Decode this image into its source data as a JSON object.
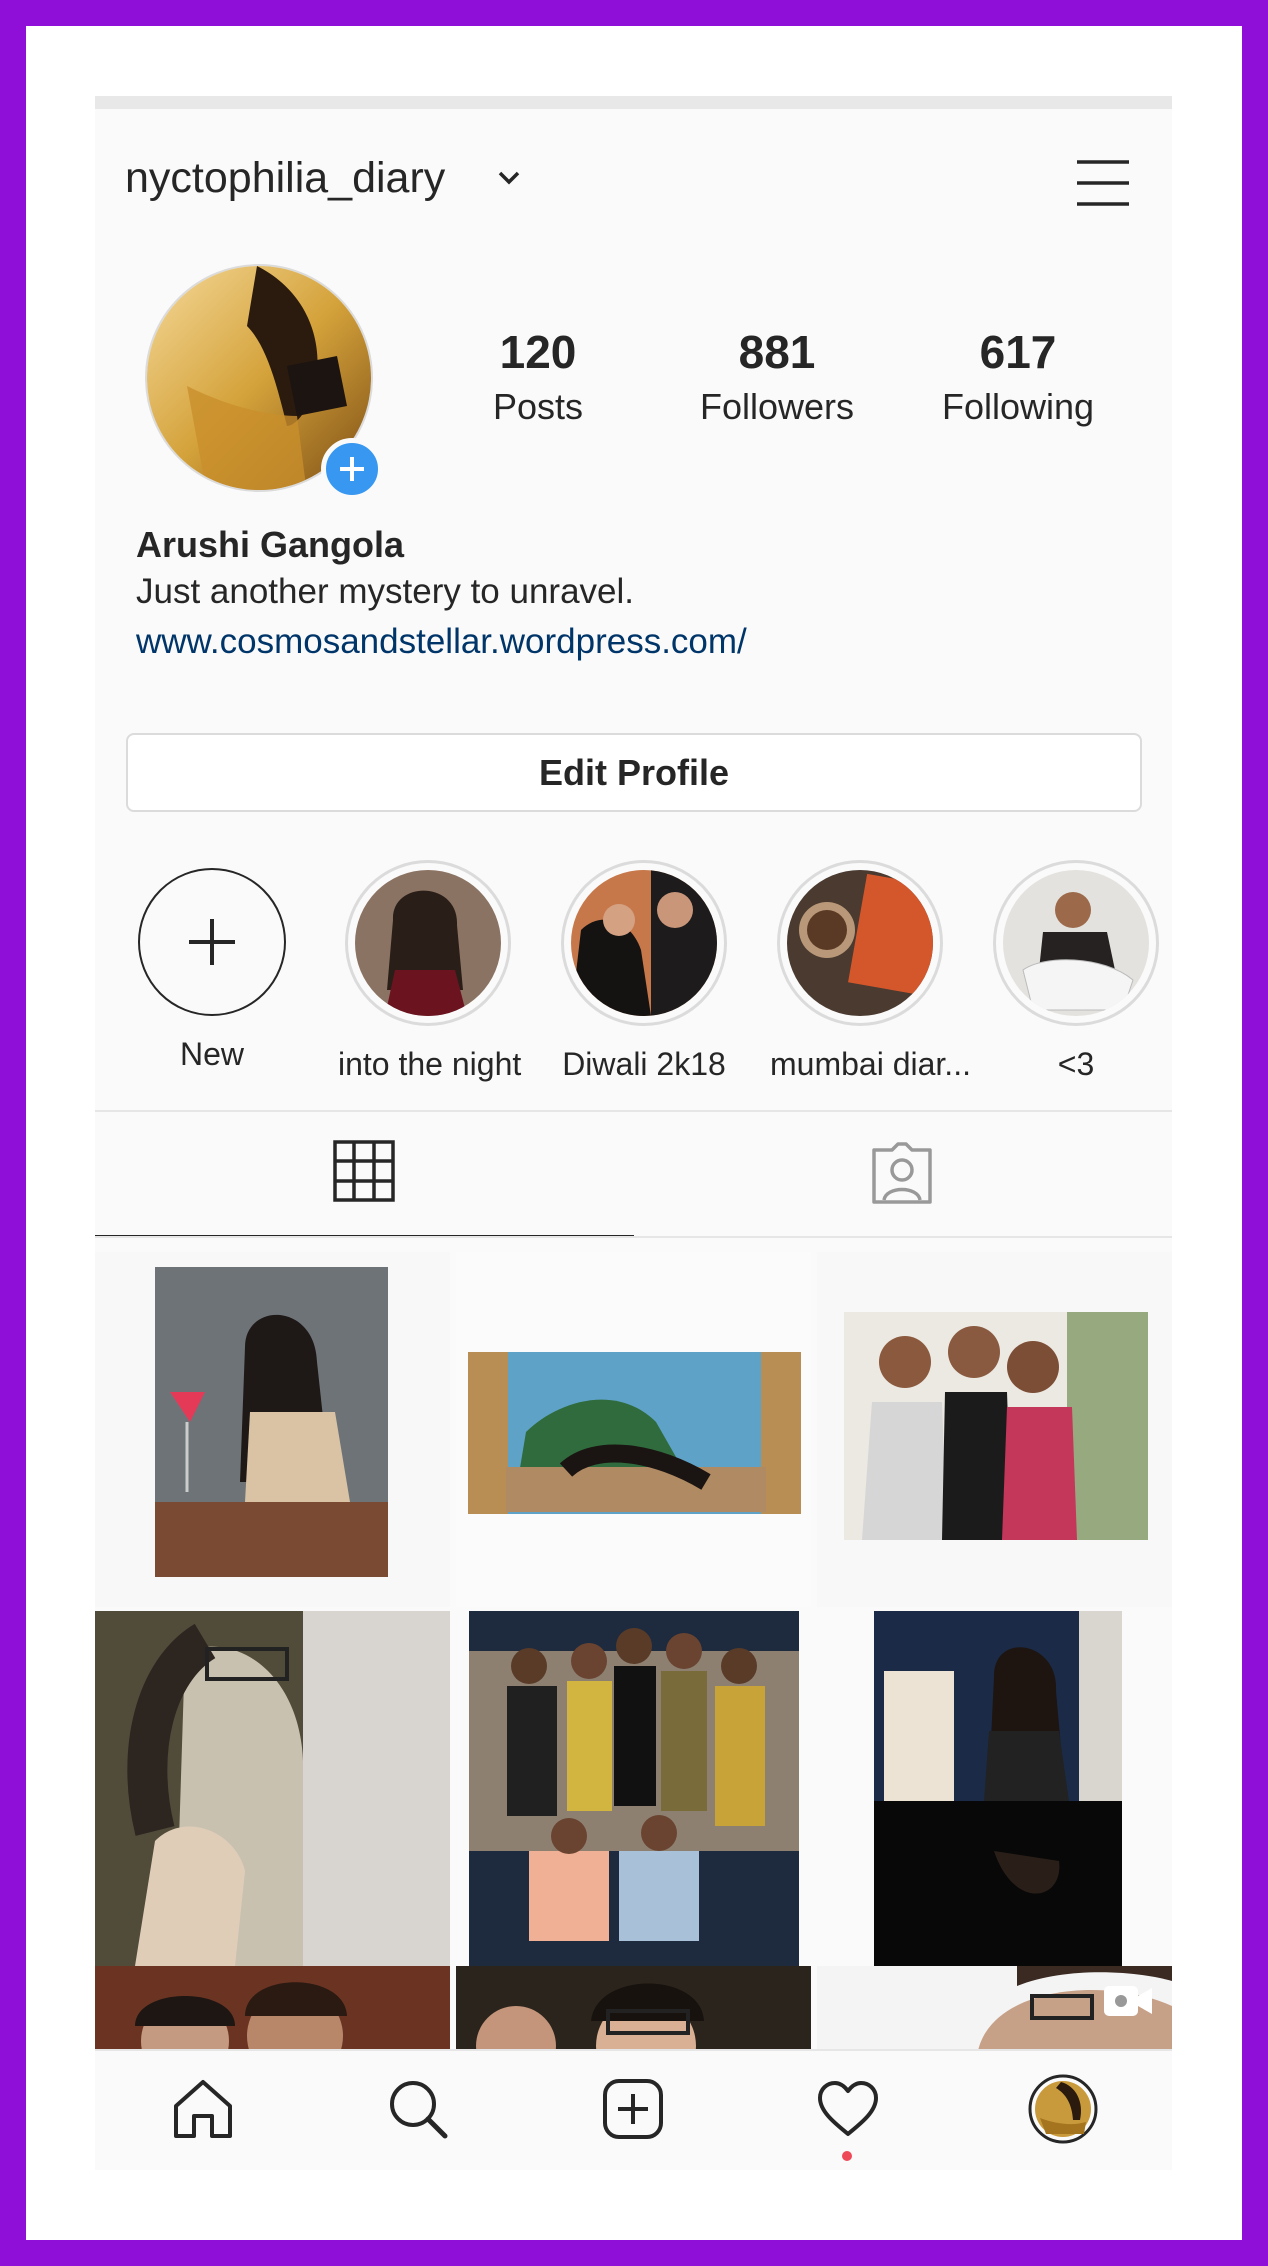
{
  "profile": {
    "username": "nyctophilia_diary",
    "full_name": "Arushi Gangola",
    "bio": "Just another mystery to unravel.",
    "website": "www.cosmosandstellar.wordpress.com/",
    "edit_label": "Edit Profile"
  },
  "stats": [
    {
      "value": "120",
      "label": "Posts"
    },
    {
      "value": "881",
      "label": "Followers"
    },
    {
      "value": "617",
      "label": "Following"
    }
  ],
  "highlights": [
    {
      "label": "New"
    },
    {
      "label": "into the night"
    },
    {
      "label": "Diwali 2k18"
    },
    {
      "label": "mumbai diar..."
    },
    {
      "label": "<3"
    }
  ],
  "tabs": {
    "grid": "grid-icon",
    "tagged": "tagged-icon"
  },
  "nav": [
    "home-icon",
    "search-icon",
    "add-post-icon",
    "activity-heart-icon",
    "profile-avatar-icon"
  ],
  "colors": {
    "brand_border": "#8f0fd8",
    "link": "#003569",
    "badge": "#3897f0",
    "notification": "#ed4956"
  }
}
